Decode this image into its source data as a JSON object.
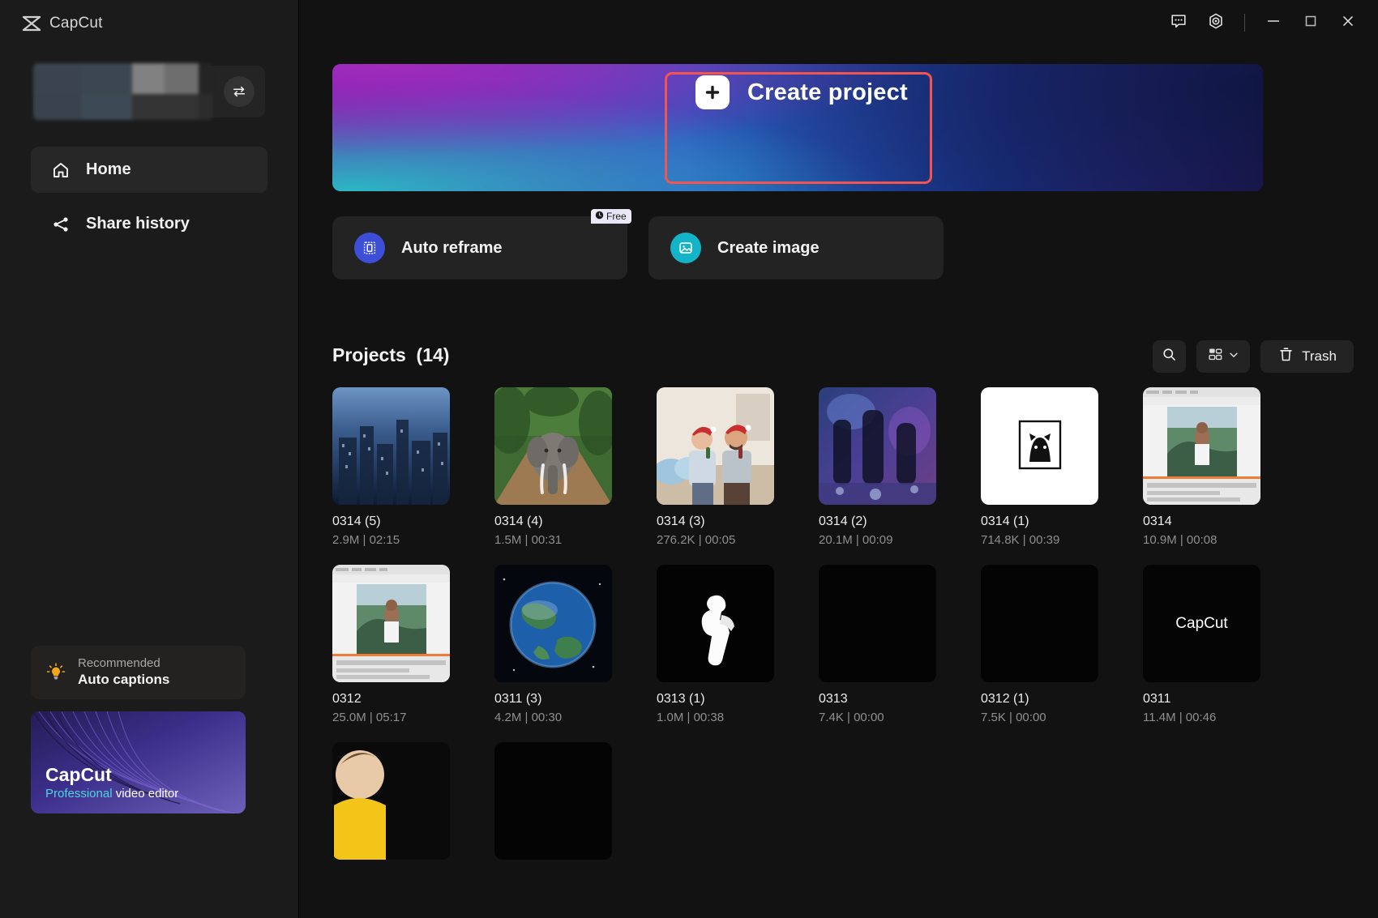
{
  "app": {
    "brand": "CapCut",
    "logo_icon": "capcut-logo-icon"
  },
  "titlebar": {
    "feedback_icon": "chat-bubble-icon",
    "settings_icon": "gear-icon",
    "minimize_icon": "minimize-icon",
    "maximize_icon": "maximize-icon",
    "close_icon": "close-icon"
  },
  "sidebar": {
    "profile": {
      "swap_icon": "swap-account-icon"
    },
    "items": [
      {
        "label": "Home",
        "icon": "home-icon",
        "active": true
      },
      {
        "label": "Share history",
        "icon": "share-icon",
        "active": false
      }
    ],
    "recommended": {
      "icon": "lightbulb-icon",
      "eyebrow": "Recommended",
      "title": "Auto captions"
    },
    "promo": {
      "title": "CapCut",
      "subtitle_accent": "Professional",
      "subtitle_rest": " video editor"
    }
  },
  "hero": {
    "create_label": "Create project",
    "plus_icon": "plus-icon",
    "highlight_color": "#f3544e"
  },
  "quick_actions": [
    {
      "id": "auto-reframe",
      "label": "Auto reframe",
      "icon": "auto-reframe-icon",
      "icon_color": "#3d4fd6",
      "badge": {
        "label": "Free",
        "icon": "clock-icon"
      }
    },
    {
      "id": "create-image",
      "label": "Create image",
      "icon": "image-icon",
      "icon_color": "#14b4c8",
      "badge": null
    }
  ],
  "projects": {
    "heading": "Projects",
    "count_label": "(14)",
    "toolbar": {
      "search_icon": "search-icon",
      "view_icon": "grid-view-icon",
      "view_chevron_icon": "chevron-down-icon",
      "trash_icon": "trash-icon",
      "trash_label": "Trash"
    },
    "items": [
      {
        "title": "0314 (5)",
        "meta": "2.9M | 02:15",
        "thumb": "city-night"
      },
      {
        "title": "0314 (4)",
        "meta": "1.5M | 00:31",
        "thumb": "elephant-forest"
      },
      {
        "title": "0314 (3)",
        "meta": "276.2K | 00:05",
        "thumb": "couple-santa"
      },
      {
        "title": "0314 (2)",
        "meta": "20.1M | 00:09",
        "thumb": "dance-club"
      },
      {
        "title": "0314 (1)",
        "meta": "714.8K | 00:39",
        "thumb": "white-cat-frame"
      },
      {
        "title": "0314",
        "meta": "10.9M | 00:08",
        "thumb": "screen-editor"
      },
      {
        "title": "0312",
        "meta": "25.0M | 05:17",
        "thumb": "screen-editor"
      },
      {
        "title": "0311 (3)",
        "meta": "4.2M | 00:30",
        "thumb": "earth-space"
      },
      {
        "title": "0313 (1)",
        "meta": "1.0M | 00:38",
        "thumb": "black-figure"
      },
      {
        "title": "0313",
        "meta": "7.4K | 00:00",
        "thumb": "black"
      },
      {
        "title": "0312 (1)",
        "meta": "7.5K | 00:00",
        "thumb": "black"
      },
      {
        "title": "0311",
        "meta": "11.4M | 00:46",
        "thumb": "capcut-text"
      },
      {
        "title": "",
        "meta": "",
        "thumb": "child-yellow"
      },
      {
        "title": "",
        "meta": "",
        "thumb": "black"
      }
    ]
  }
}
